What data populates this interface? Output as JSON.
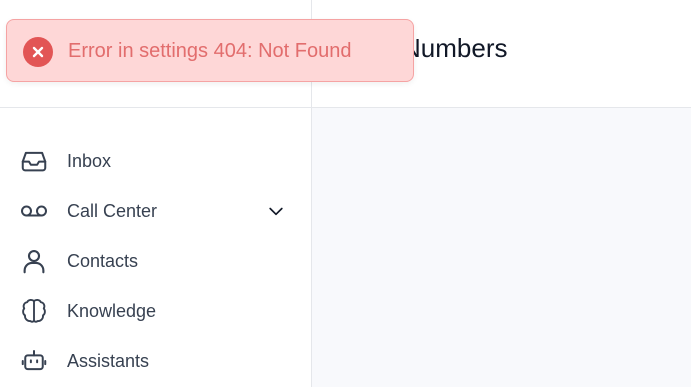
{
  "page": {
    "title": "Numbers"
  },
  "sidebar": {
    "items": [
      {
        "label": "Inbox",
        "icon": "inbox-icon"
      },
      {
        "label": "Call Center",
        "icon": "voicemail-icon",
        "expandable": true
      },
      {
        "label": "Contacts",
        "icon": "user-icon"
      },
      {
        "label": "Knowledge",
        "icon": "brain-icon"
      },
      {
        "label": "Assistants",
        "icon": "bot-icon"
      }
    ]
  },
  "toast": {
    "type": "error",
    "message": "Error in settings 404: Not Found",
    "icon": "close-circle-icon"
  },
  "colors": {
    "toast_bg": "#fed7d7",
    "toast_text": "#e26d6d",
    "toast_icon": "#e25555",
    "main_bg": "#f8f9fc",
    "nav_text": "#374151"
  }
}
